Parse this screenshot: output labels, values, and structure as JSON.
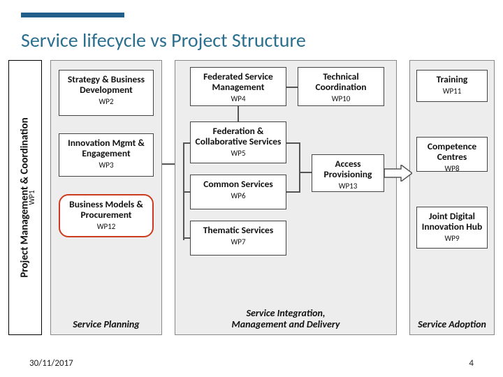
{
  "title": "Service lifecycle vs Project Structure",
  "footer": {
    "date": "30/11/2017",
    "page": "4"
  },
  "wp1": {
    "title": "Project Management & Coordination",
    "code": "WP1"
  },
  "phases": {
    "planning": "Service Planning",
    "integration": "Service Integration,\nManagement and Delivery",
    "adoption": "Service Adoption"
  },
  "boxes": {
    "wp2": {
      "name": "Strategy & Business Development",
      "code": "WP2"
    },
    "wp3": {
      "name": "Innovation Mgmt & Engagement",
      "code": "WP3"
    },
    "wp12": {
      "name": "Business Models & Procurement",
      "code": "WP12"
    },
    "wp4": {
      "name": "Federated Service Management",
      "code": "WP4"
    },
    "wp10": {
      "name": "Technical Coordination",
      "code": "WP10"
    },
    "wp5": {
      "name": "Federation & Collaborative Services",
      "code": "WP5"
    },
    "wp6": {
      "name": "Common Services",
      "code": "WP6"
    },
    "wp7": {
      "name": "Thematic Services",
      "code": "WP7"
    },
    "wp13": {
      "name": "Access Provisioning",
      "code": "WP13"
    },
    "wp11": {
      "name": "Training",
      "code": "WP11"
    },
    "wp8": {
      "name": "Competence Centres",
      "code": "WP8"
    },
    "wp9": {
      "name": "Joint Digital Innovation Hub",
      "code": "WP9"
    }
  }
}
